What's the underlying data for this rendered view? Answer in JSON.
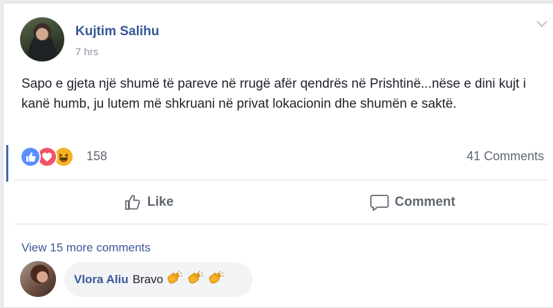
{
  "post": {
    "author": "Kujtim Salihu",
    "time": "7 hrs",
    "text": "Sapo e gjeta një shumë të pareve në rrugë afër qendrës në Prishtinë...nëse e dini kujt i kanë humb, ju lutem më shkruani në privat lokacionin dhe shumën e saktë.",
    "reactions": [
      "like-icon",
      "love-icon",
      "haha-icon"
    ],
    "reaction_count": "158",
    "comments_count": "41 Comments"
  },
  "actions": {
    "like": "Like",
    "comment": "Comment"
  },
  "comments": {
    "view_more": "View 15 more comments",
    "items": [
      {
        "author": "Vlora Aliu",
        "text": "Bravo",
        "emojis": [
          "clapping-hands",
          "clapping-hands",
          "clapping-hands"
        ]
      }
    ]
  },
  "colors": {
    "link": "#365899",
    "like": "#5890ff",
    "love": "#f25268",
    "haha": "#f7b125"
  }
}
